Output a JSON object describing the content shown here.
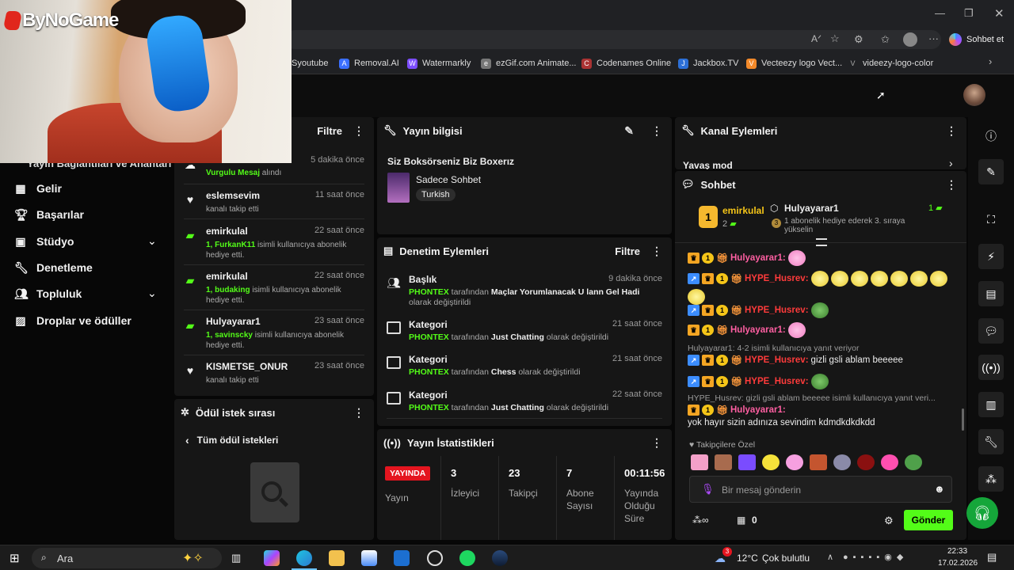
{
  "browser": {
    "copilot_label": "Sohbet et",
    "bookmarks": [
      "Syoutube",
      "Removal.AI",
      "Watermarkly",
      "ezGif.com Animate...",
      "Codenames Online",
      "Jackbox.TV",
      "Vecteezy logo Vect...",
      "videezy-logo-color"
    ]
  },
  "overlay": {
    "logo_text": "ByNoGame"
  },
  "sidebar": {
    "partial_item": "Yayın Bağlantıları ve Anahtarı",
    "items": [
      {
        "label": "Gelir",
        "icon": "revenue-icon"
      },
      {
        "label": "Başarılar",
        "icon": "trophy-icon"
      },
      {
        "label": "Stüdyo",
        "icon": "studio-icon",
        "expandable": true
      },
      {
        "label": "Denetleme",
        "icon": "wrench-icon"
      },
      {
        "label": "Topluluk",
        "icon": "community-icon",
        "expandable": true
      },
      {
        "label": "Droplar ve ödüller",
        "icon": "gift-icon"
      }
    ]
  },
  "activity": {
    "filter_label": "Filtre",
    "items": [
      {
        "name": "",
        "time": "5 dakika önce",
        "desc_green": "Vurgulu Mesaj",
        "desc": " alındı",
        "icon": "highlight-icon"
      },
      {
        "name": "eslemsevim",
        "time": "11 saat önce",
        "desc": "kanalı takip etti",
        "icon": "heart-icon"
      },
      {
        "name": "emirkulal",
        "time": "22 saat önce",
        "desc_green": "1, FurkanK11",
        "desc": " isimli kullanıcıya abonelik hediye etti.",
        "icon": "gift-sub-icon"
      },
      {
        "name": "emirkulal",
        "time": "22 saat önce",
        "desc_green": "1, budaking",
        "desc": " isimli kullanıcıya abonelik hediye etti.",
        "icon": "gift-sub-icon"
      },
      {
        "name": "Hulyayarar1",
        "time": "23 saat önce",
        "desc_green": "1, savinscky",
        "desc": " isimli kullanıcıya abonelik hediye etti.",
        "icon": "gift-sub-icon"
      },
      {
        "name": "KISMETSE_ONUR",
        "time": "23 saat önce",
        "desc": "kanalı takip etti",
        "icon": "heart-icon"
      }
    ]
  },
  "rewards": {
    "title": "Ödül istek sırası",
    "all_label": "Tüm ödül istekleri"
  },
  "stream_info": {
    "title": "Yayın bilgisi",
    "stream_title": "Siz Boksörseniz Biz Boxerız",
    "category": "Sadece Sohbet",
    "tag": "Turkish"
  },
  "moderation": {
    "title": "Denetim Eylemleri",
    "filter_label": "Filtre",
    "rows": [
      {
        "name": "Başlık",
        "time": "9 dakika önce",
        "user": "PHONTEX",
        "mid": " tarafından ",
        "value": "Maçlar Yorumlanacak U lann Gel Hadi",
        "end": " olarak değiştirildi"
      },
      {
        "name": "Kategori",
        "time": "21 saat önce",
        "user": "PHONTEX",
        "mid": " tarafından ",
        "value": "Just Chatting",
        "end": " olarak değiştirildi"
      },
      {
        "name": "Kategori",
        "time": "21 saat önce",
        "user": "PHONTEX",
        "mid": " tarafından ",
        "value": "Chess",
        "end": " olarak değiştirildi"
      },
      {
        "name": "Kategori",
        "time": "22 saat önce",
        "user": "PHONTEX",
        "mid": " tarafından ",
        "value": "Just Chatting",
        "end": " olarak değiştirildi"
      }
    ]
  },
  "stats": {
    "title": "Yayın İstatistikleri",
    "live_badge": "YAYINDA",
    "live_label": "Yayın",
    "items": [
      {
        "value": "3",
        "label": "İzleyici"
      },
      {
        "value": "23",
        "label": "Takipçi"
      },
      {
        "value": "7",
        "label": "Abone Sayısı"
      },
      {
        "value": "00:11:56",
        "label": "Yayında Olduğu Süre"
      }
    ]
  },
  "channel_actions": {
    "title": "Kanal Eylemleri",
    "partial_item": "Yavaş mod"
  },
  "chat": {
    "title": "Sohbet",
    "leader": {
      "rank": "1",
      "name": "emirkulal",
      "count": "2"
    },
    "gifter": {
      "name": "Hulyayarar1",
      "count": "1",
      "desc": "1 abonelik hediye ederek 3. sıraya yükselin",
      "rank": "3"
    },
    "messages": [
      {
        "user": "Hulyayarar1:",
        "color": "#ff5fa2",
        "text": ""
      },
      {
        "user": "HYPE_Husrev:",
        "color": "#ff3b3b",
        "text": ""
      },
      {
        "user": "HYPE_Husrev:",
        "color": "#ff3b3b",
        "text": ""
      },
      {
        "user": "Hulyayarar1:",
        "color": "#ff5fa2",
        "text": ""
      },
      {
        "user": "HYPE_Husrev:",
        "color": "#ff3b3b",
        "text": "gizli gsli ablam beeeee"
      },
      {
        "user": "HYPE_Husrev:",
        "color": "#ff3b3b",
        "text": ""
      },
      {
        "user": "Hulyayarar1:",
        "color": "#ff5fa2",
        "text": "yok hayır sizin adınıza sevindim kdmdkdkdkdd"
      }
    ],
    "reply1": "Hulyayarar1: 4-2 isimli kullanıcıya yanıt veriyor",
    "reply2": "HYPE_Husrev: gizli gsli ablam beeeee isimli kullanıcıya yanıt veri...",
    "followers_only": "Takipçilere Özel",
    "input_placeholder": "Bir mesaj gönderin",
    "points": "0",
    "send_label": "Gönder"
  },
  "taskbar": {
    "search": "Ara",
    "weather_temp": "12°C",
    "weather_desc": "Çok bulutlu",
    "weather_badge": "3",
    "time": "22:33",
    "date": "17.02.2026"
  }
}
